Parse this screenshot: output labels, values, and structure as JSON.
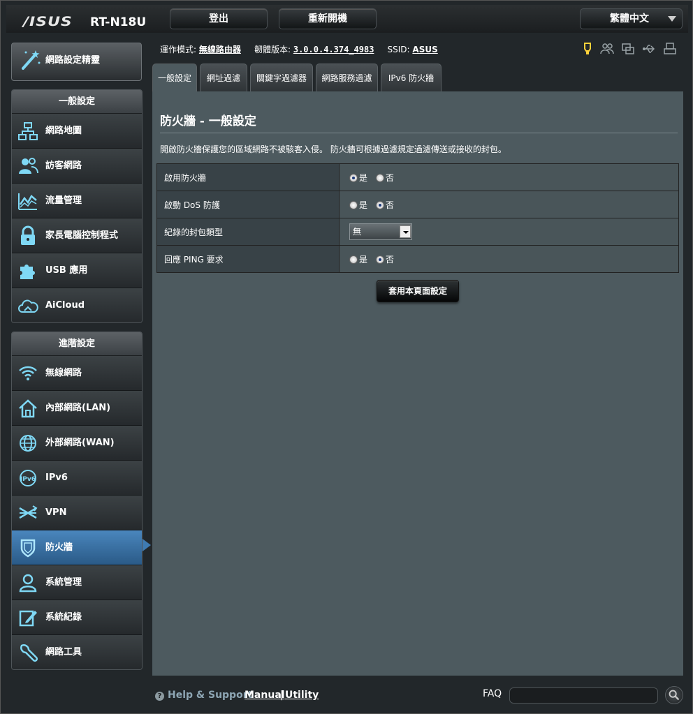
{
  "header": {
    "logo": "/ISUS",
    "model": "RT-N18U",
    "logout_label": "登出",
    "reboot_label": "重新開機",
    "language": "繁體中文"
  },
  "wizard_label": "網路設定精靈",
  "nav": {
    "general_title": "一般設定",
    "general_items": [
      {
        "label": "網路地圖",
        "icon": "network-map-icon"
      },
      {
        "label": "訪客網路",
        "icon": "guest-network-icon"
      },
      {
        "label": "流量管理",
        "icon": "traffic-manager-icon"
      },
      {
        "label": "家長電腦控制程式",
        "icon": "parental-lock-icon"
      },
      {
        "label": "USB 應用",
        "icon": "usb-puzzle-icon"
      },
      {
        "label": "AiCloud",
        "icon": "cloud-icon"
      }
    ],
    "advanced_title": "進階設定",
    "advanced_items": [
      {
        "label": "無線網路",
        "icon": "wifi-icon"
      },
      {
        "label": "內部網路(LAN)",
        "icon": "home-icon"
      },
      {
        "label": "外部網路(WAN)",
        "icon": "globe-icon"
      },
      {
        "label": "IPv6",
        "icon": "ipv6-icon"
      },
      {
        "label": "VPN",
        "icon": "vpn-icon"
      },
      {
        "label": "防火牆",
        "icon": "shield-icon"
      },
      {
        "label": "系統管理",
        "icon": "admin-icon"
      },
      {
        "label": "系統紀錄",
        "icon": "log-icon"
      },
      {
        "label": "網路工具",
        "icon": "tools-icon"
      }
    ]
  },
  "info": {
    "mode_label": "運作模式:",
    "mode_value": "無線路由器",
    "firmware_label": "韌體版本:",
    "firmware_value": "3.0.0.4.374_4983",
    "ssid_label": "SSID:",
    "ssid_value": "ASUS"
  },
  "tabs": [
    "一般設定",
    "網址過濾",
    "關鍵字過濾器",
    "網路服務過濾",
    "IPv6 防火牆"
  ],
  "panel": {
    "title": "防火牆 - 一般設定",
    "description": "開啟防火牆保護您的區域網路不被駭客入侵。 防火牆可根據過濾規定過濾傳送或接收的封包。",
    "rows": [
      {
        "label": "啟用防火牆",
        "yes": "是",
        "no": "否",
        "selected": "yes"
      },
      {
        "label": "啟動 DoS 防護",
        "yes": "是",
        "no": "否",
        "selected": "no"
      },
      {
        "label": "紀錄的封包類型",
        "select_value": "無"
      },
      {
        "label": "回應 PING 要求",
        "yes": "是",
        "no": "否",
        "selected": "no"
      }
    ],
    "apply_label": "套用本頁面設定"
  },
  "footer": {
    "help": "Help & Support",
    "manual": "Manual",
    "separator": "|",
    "utility": "Utility",
    "faq": "FAQ"
  },
  "colors": {
    "panel_bg": "#4d5a5f",
    "active_nav": "#3f7bb2",
    "icon_cyan": "#7fd8f5"
  }
}
